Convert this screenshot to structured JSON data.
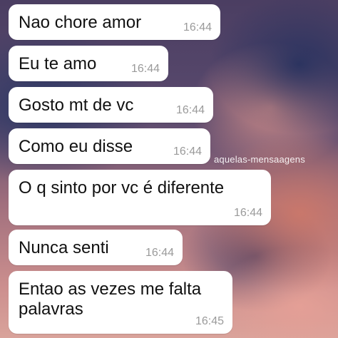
{
  "messages": [
    {
      "text": "Nao chore amor",
      "time": "16:44"
    },
    {
      "text": "Eu te amo",
      "time": "16:44"
    },
    {
      "text": "Gosto mt de vc",
      "time": "16:44"
    },
    {
      "text": "Como eu disse",
      "time": "16:44"
    },
    {
      "text": "O q sinto por vc é diferente",
      "time": "16:44"
    },
    {
      "text": "Nunca senti",
      "time": "16:44"
    },
    {
      "text": "Entao as vezes me falta palavras",
      "time": "16:45"
    }
  ],
  "watermark": "aquelas-mensaagens"
}
